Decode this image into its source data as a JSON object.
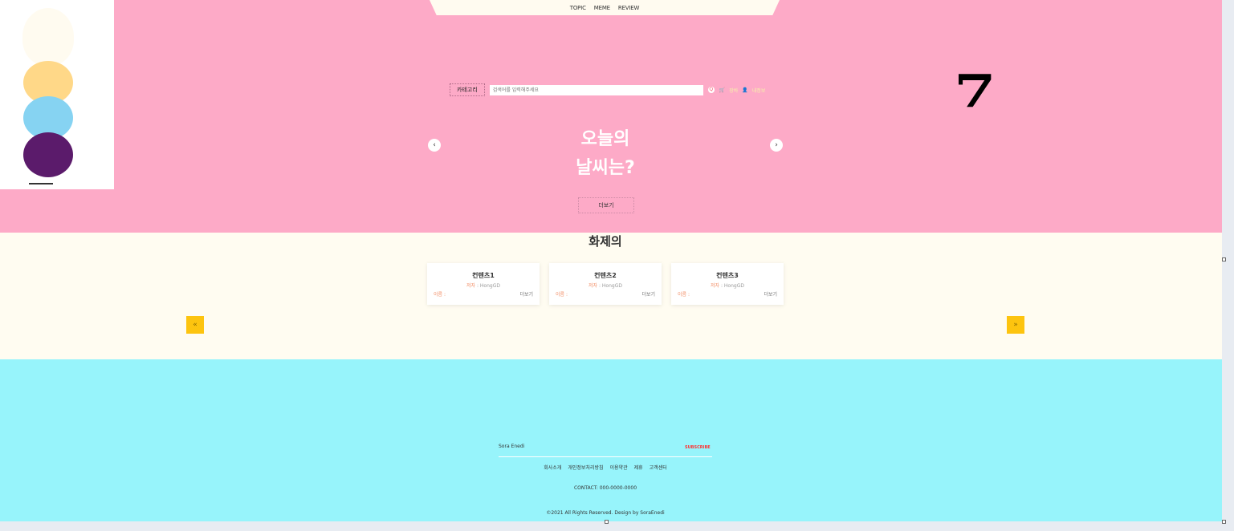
{
  "topnav": {
    "items": [
      "TOPIC",
      "MEME",
      "REVIEW"
    ]
  },
  "search": {
    "category": "카테고리",
    "placeholder": "검색어를 입력해주세요",
    "button": "Q"
  },
  "header_links": {
    "cart": "장바",
    "signup": "내정보"
  },
  "hero": {
    "title_line1": "오늘의",
    "title_line2": "날씨는?",
    "button": "더보기",
    "prev": "‹",
    "next": "›"
  },
  "brand_mark": "7",
  "trending": {
    "title": "화제의",
    "cards": [
      {
        "title": "컨텐츠1",
        "author_label": "저자",
        "author": ": HongGD",
        "name_label": "이름 :",
        "more": "더보기"
      },
      {
        "title": "컨텐츠2",
        "author_label": "저자",
        "author": ": HongGD",
        "name_label": "이름 :",
        "more": "더보기"
      },
      {
        "title": "컨텐츠3",
        "author_label": "저자",
        "author": ": HongGD",
        "name_label": "이름 :",
        "more": "더보기"
      }
    ],
    "prev": "«",
    "next": "»"
  },
  "footer": {
    "brand": "Sora Enedi",
    "subscribe": "SUBSCRIBE",
    "links": [
      "회사소개",
      "개인정보처리방침",
      "이용약관",
      "제휴",
      "고객센터"
    ],
    "contact": "CONTACT: 000-0000-0000",
    "copyright": "©2021 All Rights Reserved. Design by SoraEnedi"
  },
  "colors": {
    "hero": "#fdaac7",
    "trend_bg": "#fffcf1",
    "footer": "#97f4fb",
    "accent": "#fdc40f"
  }
}
